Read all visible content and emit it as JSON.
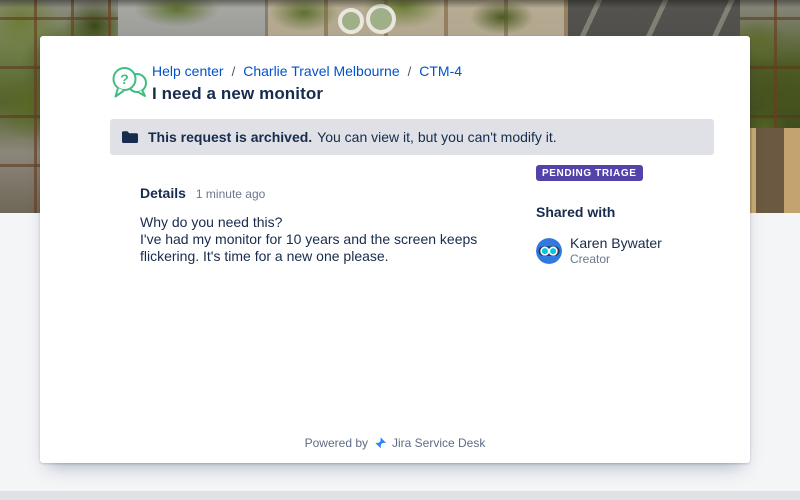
{
  "breadcrumb": {
    "separator": "/",
    "items": [
      "Help center",
      "Charlie Travel Melbourne",
      "CTM-4"
    ]
  },
  "request": {
    "title": "I need a new monitor",
    "status": "PENDING TRIAGE",
    "archived_notice": {
      "bold": "This request is archived.",
      "text": "You can view it, but you can't modify it."
    },
    "details": {
      "heading": "Details",
      "timestamp": "1 minute ago",
      "question": "Why do you need this?",
      "answer": "I've had my monitor for 10 years and the screen keeps flickering. It's time for a new one please."
    },
    "shared_with": {
      "heading": "Shared with",
      "people": [
        {
          "name": "Karen Bywater",
          "role": "Creator"
        }
      ]
    }
  },
  "footer": {
    "powered_by": "Powered by",
    "product": "Jira Service Desk"
  },
  "colors": {
    "link": "#0052CC",
    "heading": "#172B4D",
    "muted": "#6B778C",
    "banner_bg": "#DFE1E6",
    "badge_bg": "#5243AA",
    "page_bg": "#F4F5F7",
    "help_icon_green": "#41BD83",
    "avatar_blue": "#3179DE",
    "jira_blue": "#2684FF"
  }
}
